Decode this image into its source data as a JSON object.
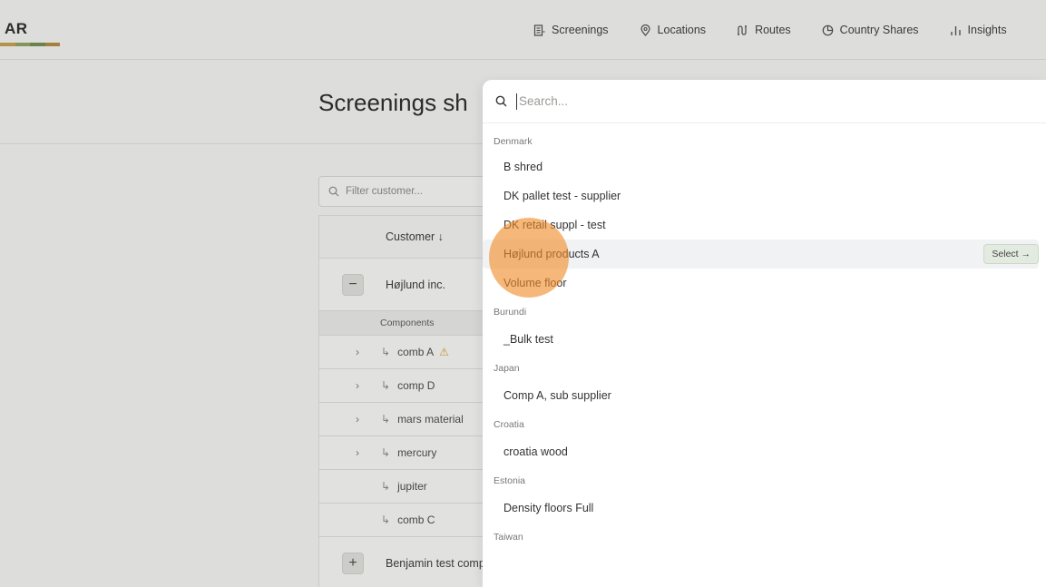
{
  "header": {
    "logo_text": "AR",
    "logo_bar_colors": [
      "#c9a24a",
      "#8ea35b",
      "#6f8c4c",
      "#b8883c"
    ],
    "nav": [
      {
        "label": "Screenings",
        "icon": "document-list-icon"
      },
      {
        "label": "Locations",
        "icon": "map-pin-icon"
      },
      {
        "label": "Routes",
        "icon": "route-icon"
      },
      {
        "label": "Country Shares",
        "icon": "pie-chart-icon"
      },
      {
        "label": "Insights",
        "icon": "bar-chart-icon"
      }
    ]
  },
  "page": {
    "title": "Screenings sh",
    "filter_placeholder": "Filter customer...",
    "table": {
      "customer_header": "Customer ↓",
      "customers": [
        {
          "toggle": "−",
          "name": "Højlund inc."
        },
        {
          "toggle": "+",
          "name": "Benjamin test comp"
        }
      ],
      "components_header": "Components",
      "components": [
        {
          "chevron": "›",
          "name": "comb A",
          "warning": true
        },
        {
          "chevron": "›",
          "name": "comp D",
          "warning": false
        },
        {
          "chevron": "›",
          "name": "mars material",
          "warning": false
        },
        {
          "chevron": "›",
          "name": "mercury",
          "warning": false
        },
        {
          "chevron": "",
          "name": "jupiter",
          "warning": false
        },
        {
          "chevron": "",
          "name": "comb C",
          "warning": false
        }
      ]
    }
  },
  "palette": {
    "search_placeholder": "Search...",
    "select_label": "Select →",
    "groups": [
      {
        "country": "Denmark",
        "items": [
          "B shred",
          "DK pallet test - supplier",
          "DK retail suppl - test",
          "Højlund products A",
          "Volume floor"
        ]
      },
      {
        "country": "Burundi",
        "items": [
          "_Bulk test"
        ]
      },
      {
        "country": "Japan",
        "items": [
          "Comp A, sub supplier"
        ]
      },
      {
        "country": "Croatia",
        "items": [
          "croatia wood"
        ]
      },
      {
        "country": "Estonia",
        "items": [
          "Density floors Full"
        ]
      },
      {
        "country": "Taiwan",
        "items": []
      }
    ],
    "active_item": "Højlund products A"
  },
  "colors": {
    "highlight": "#f1f2f4",
    "select_pill": "#e3ebe0",
    "cursor": "#f08c28",
    "warning": "#e0a020"
  }
}
